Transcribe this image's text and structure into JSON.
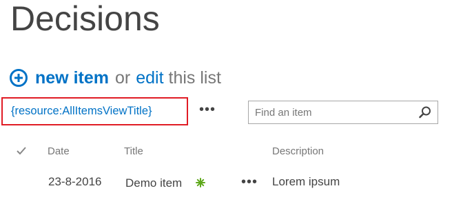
{
  "page": {
    "title": "Decisions"
  },
  "commands": {
    "new_item": "new item",
    "or": "or",
    "edit": "edit",
    "this_list": "this list"
  },
  "view": {
    "current": "{resource:AllItemsViewTitle}",
    "more": "•••"
  },
  "search": {
    "placeholder": "Find an item"
  },
  "columns": {
    "date": "Date",
    "title": "Title",
    "description": "Description"
  },
  "rows": [
    {
      "date": "23-8-2016",
      "title": "Demo item",
      "description": "Lorem ipsum",
      "more": "•••"
    }
  ],
  "colors": {
    "accent": "#0072c6",
    "highlight_border": "#e01b24",
    "new_badge": "#5ea81b"
  },
  "icons": {
    "add": "circle-plus-icon",
    "search": "magnifier-icon",
    "select_all": "checkmark-icon",
    "new": "new-item-badge-icon"
  }
}
